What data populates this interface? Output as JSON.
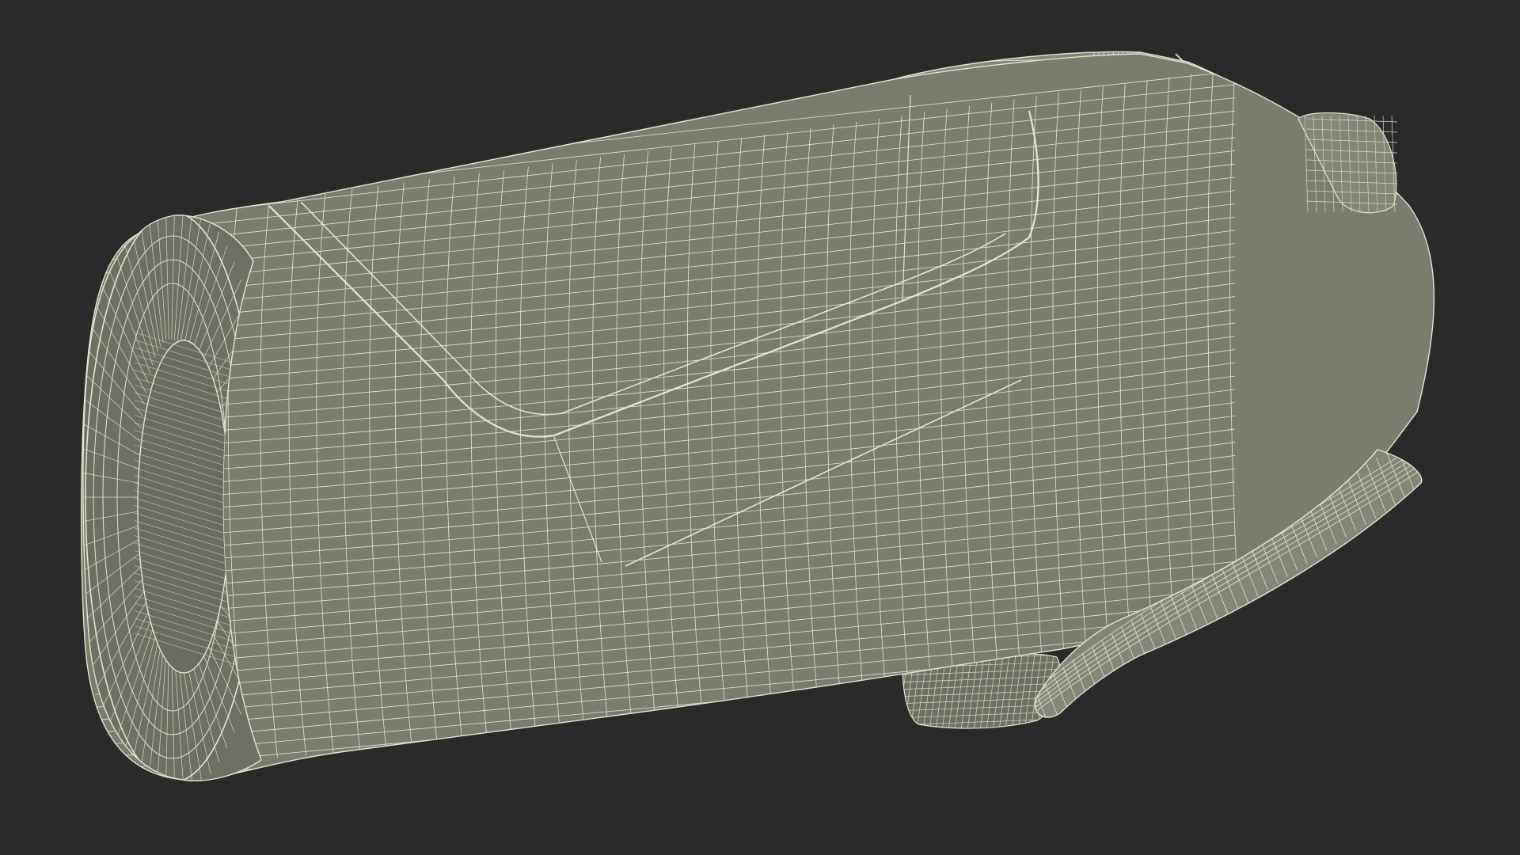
{
  "scene": {
    "subject": "wireframe-render",
    "colors": {
      "background": "#2a2a2a",
      "surface": "#7b7c70",
      "surface_shadow": "#6e6f64",
      "surface_light": "#85867a",
      "wire": "#e6e4d2",
      "wire_dense": "#d8d6c3"
    }
  }
}
